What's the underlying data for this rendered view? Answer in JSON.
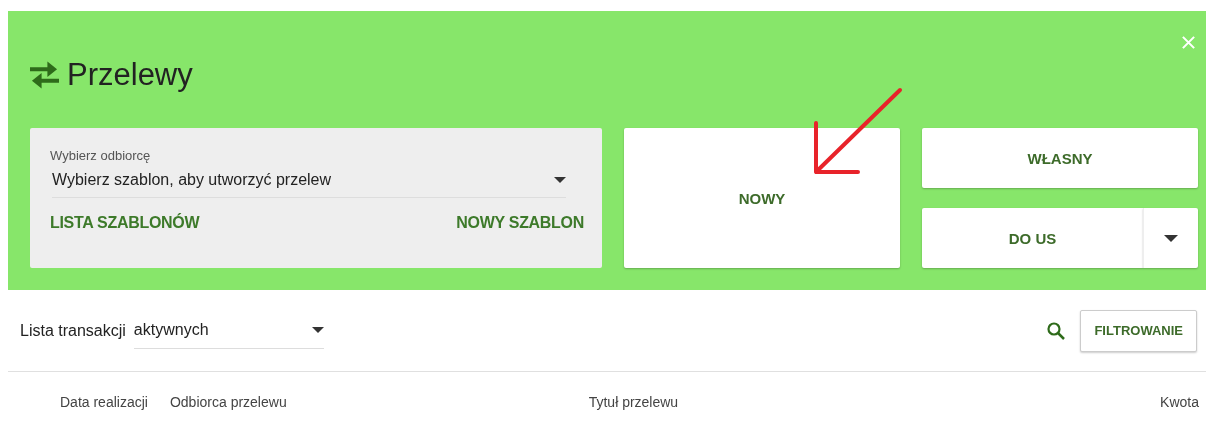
{
  "header": {
    "title": "Przelewy"
  },
  "recipient": {
    "label": "Wybierz odbiorcę",
    "value": "Wybierz szablon, aby utworzyć przelew",
    "links": [
      "LISTA SZABLONÓW",
      "NOWY SZABLON"
    ]
  },
  "actions": {
    "new": "NOWY",
    "own": "WŁASNY",
    "us": "DO US"
  },
  "list": {
    "label": "Lista transakcji",
    "filter_value": "aktywnych",
    "filter_button": "FILTROWANIE"
  },
  "table": {
    "columns": [
      "Data realizacji",
      "Odbiorca przelewu",
      "Tytuł przelewu",
      "Kwota"
    ]
  }
}
